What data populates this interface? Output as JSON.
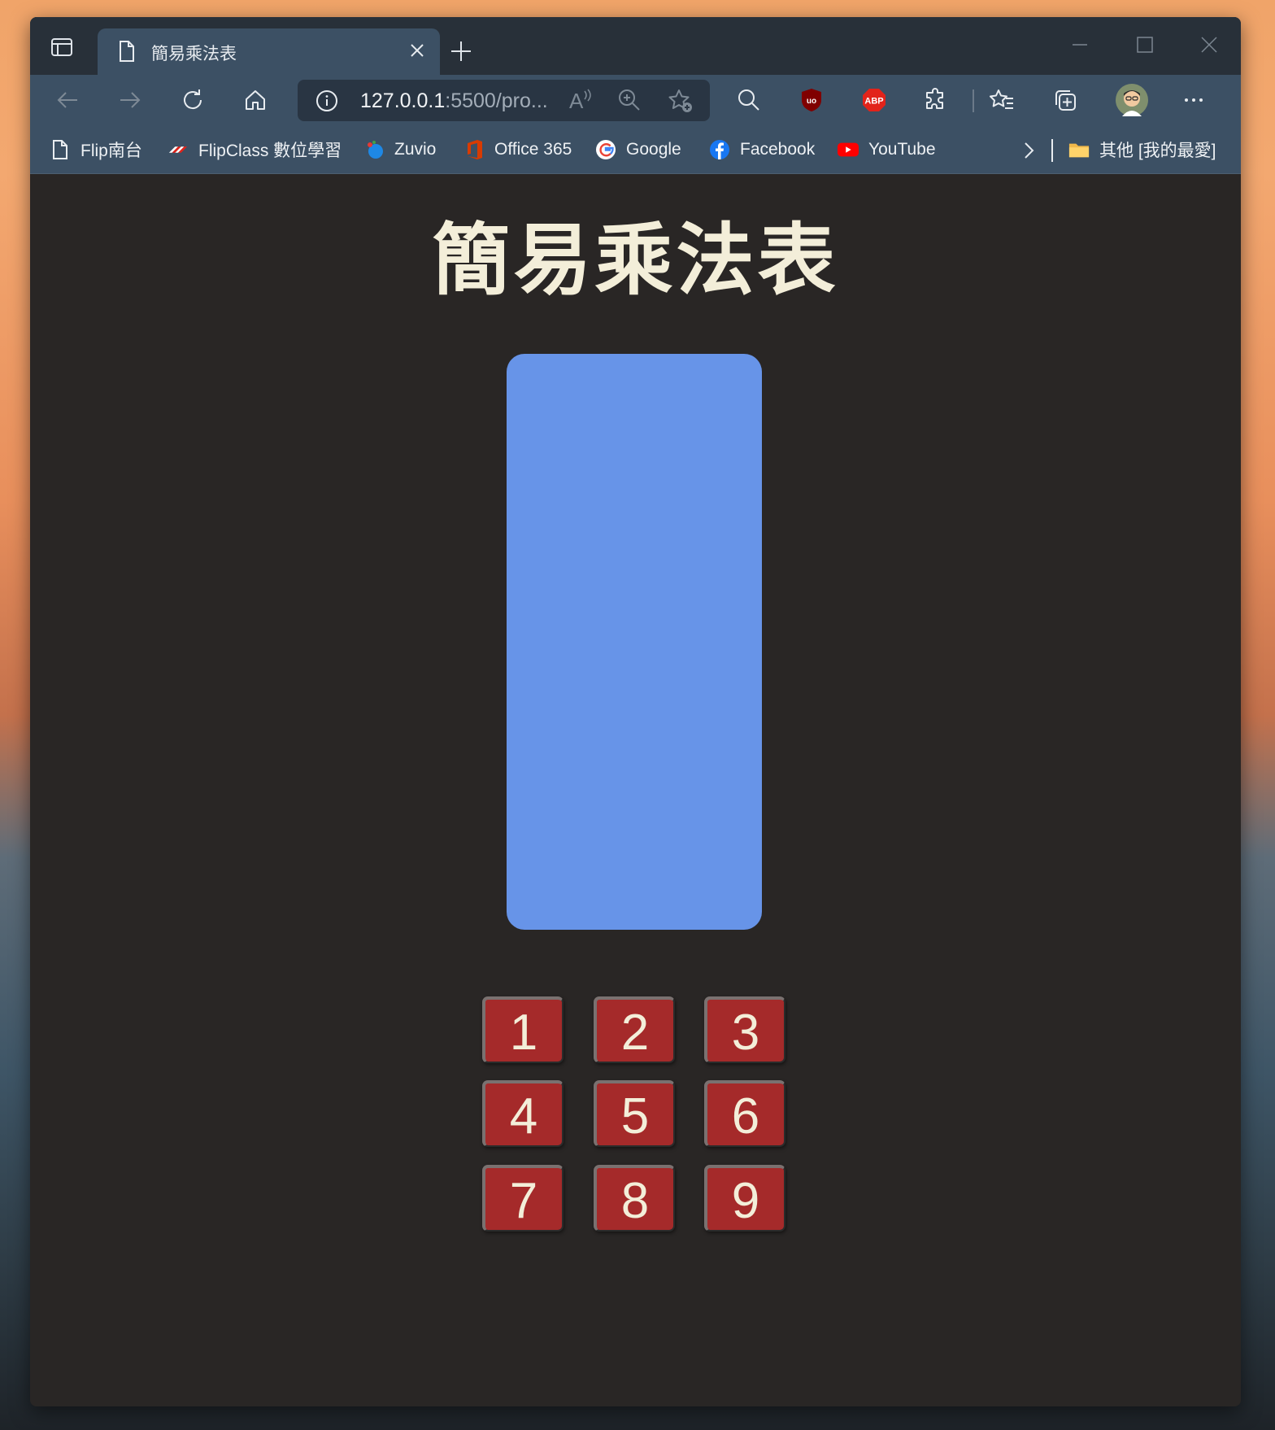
{
  "browser": {
    "tab_title": "簡易乘法表",
    "url_host": "127.0.0.1",
    "url_rest": ":5500/pro...",
    "read_aloud_label": "A",
    "bookmarks": [
      {
        "label": "Flip南台",
        "icon": "page-icon"
      },
      {
        "label": "FlipClass 數位學習",
        "icon": "flipclass-icon"
      },
      {
        "label": "Zuvio",
        "icon": "zuvio-icon"
      },
      {
        "label": "Office 365",
        "icon": "office-icon"
      },
      {
        "label": "Google",
        "icon": "google-icon"
      },
      {
        "label": "Facebook",
        "icon": "facebook-icon"
      },
      {
        "label": "YouTube",
        "icon": "youtube-icon"
      }
    ],
    "other_favorites": "其他 [我的最愛]",
    "extensions": {
      "ublock": "uo",
      "abp": "ABP"
    }
  },
  "page": {
    "title": "簡易乘法表",
    "result_panel_color": "#6794e8",
    "button_color": "#a52a2a",
    "number_buttons": [
      "1",
      "2",
      "3",
      "4",
      "5",
      "6",
      "7",
      "8",
      "9"
    ]
  }
}
